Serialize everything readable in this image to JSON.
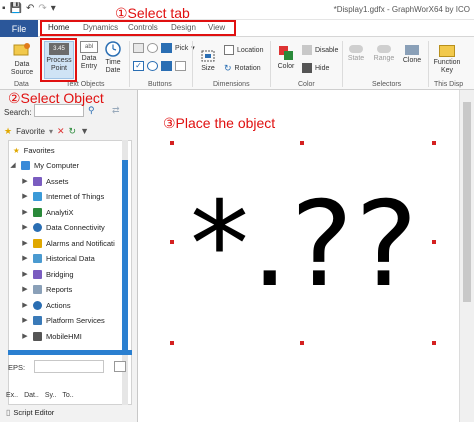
{
  "window": {
    "title": "*Display1.gdfx - GraphWorX64 by ICO"
  },
  "tabs": {
    "file": "File",
    "home": "Home",
    "dynamics": "Dynamics",
    "controls": "Controls",
    "design": "Design",
    "view": "View"
  },
  "ribbon": {
    "data_source": [
      "Data",
      "Source"
    ],
    "process_point": [
      "Process",
      "Point"
    ],
    "process_point_icon_text": "3.45",
    "data_entry": [
      "Data",
      "Entry"
    ],
    "data_entry_icon_text": "abl",
    "time_date": [
      "Time",
      "Date"
    ],
    "pick": "Pick",
    "size": "Size",
    "location": "Location",
    "rotation": "Rotation",
    "color": "Color",
    "disable": "Disable",
    "hide": "Hide",
    "state": "State",
    "range": "Range",
    "clone": "Clone",
    "function_key": [
      "Function",
      "Key"
    ],
    "groups": {
      "data": "Data",
      "text_objects": "Text Objects",
      "buttons": "Buttons",
      "dimensions": "Dimensions",
      "color": "Color",
      "selectors": "Selectors",
      "this_display": "This Disp"
    }
  },
  "left_panel": {
    "search_label": "Search:",
    "favorites_dropdown": "Favorite",
    "tree": [
      "Favorites",
      "My Computer",
      "Assets",
      "Internet of Things",
      "AnalytiX",
      "Data Connectivity",
      "Alarms and Notificati",
      "Historical Data",
      "Bridging",
      "Reports",
      "Actions",
      "Platform Services",
      "MobileHMI"
    ],
    "eps_label": "EPS:",
    "bottom_tabs": [
      "Ex..",
      "Dat..",
      "Sy..",
      "To.."
    ],
    "script_editor": "Script Editor"
  },
  "canvas": {
    "text": "*.??"
  },
  "annotations": {
    "select_tab": "①Select tab",
    "select_object": "②Select Object",
    "place_object": "③Place the object"
  },
  "colors": {
    "annotation": "#e01010",
    "file_tab": "#2b579a",
    "selection_handle": "#d42020"
  }
}
